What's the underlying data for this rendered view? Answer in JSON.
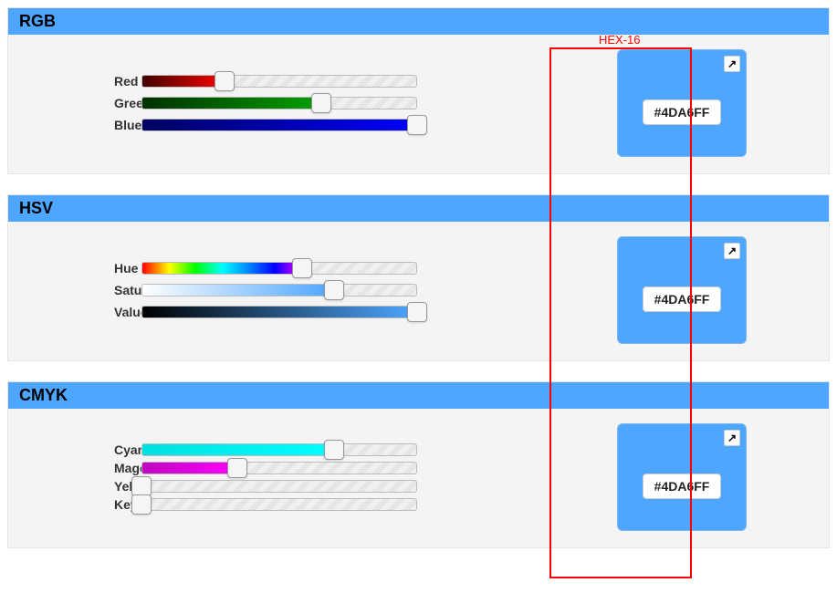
{
  "accent_color": "#4DA6FF",
  "annotation": {
    "label": "HEX-16"
  },
  "sections": {
    "rgb": {
      "title": "RGB",
      "hex": "#4DA6FF",
      "sliders": {
        "red": {
          "label": "Red",
          "percent": 30.2
        },
        "green": {
          "label": "Green",
          "percent": 65.1
        },
        "blue": {
          "label": "Blue",
          "percent": 100.0
        }
      }
    },
    "hsv": {
      "title": "HSV",
      "hex": "#4DA6FF",
      "sliders": {
        "hue": {
          "label": "Hue",
          "percent": 58.3
        },
        "saturation": {
          "label": "Saturation",
          "percent": 69.8
        },
        "value": {
          "label": "Value",
          "percent": 100.0
        }
      }
    },
    "cmyk": {
      "title": "CMYK",
      "hex": "#4DA6FF",
      "sliders": {
        "cyan": {
          "label": "Cyan",
          "percent": 69.8
        },
        "magenta": {
          "label": "Magenta",
          "percent": 34.9
        },
        "yellow": {
          "label": "Yellow",
          "percent": 0.0
        },
        "key": {
          "label": "Key",
          "percent": 0.0
        }
      }
    }
  }
}
